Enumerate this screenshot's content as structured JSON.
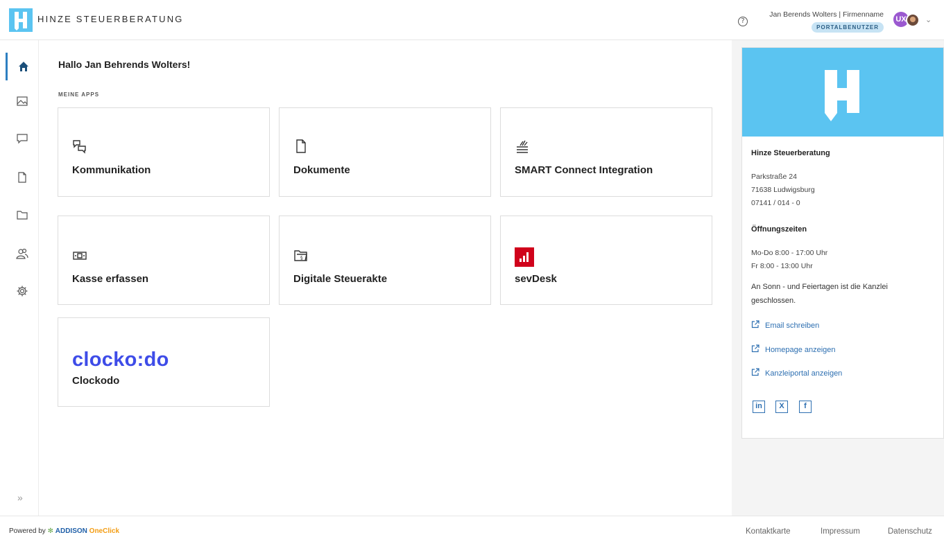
{
  "header": {
    "brand": "HINZE STEUERBERATUNG",
    "help_icon": "question-circle-icon",
    "user_name": "Jan Berends Wolters | Firmenname",
    "user_role": "PORTALBENUTZER",
    "avatar_initials": "UX"
  },
  "sidebar": {
    "items": [
      {
        "name": "home",
        "icon": "home-icon",
        "active": true
      },
      {
        "name": "images",
        "icon": "image-icon"
      },
      {
        "name": "messages",
        "icon": "chat-icon"
      },
      {
        "name": "documents",
        "icon": "document-icon"
      },
      {
        "name": "folders",
        "icon": "folder-icon"
      },
      {
        "name": "users",
        "icon": "users-icon"
      },
      {
        "name": "settings",
        "icon": "gear-icon"
      }
    ],
    "expand_label": "»"
  },
  "main": {
    "greeting": "Hallo Jan Behrends Wolters!",
    "section_title": "MEINE APPS",
    "apps": [
      {
        "label": "Kommunikation",
        "icon": "chat-bubbles-icon"
      },
      {
        "label": "Dokumente",
        "icon": "document-icon"
      },
      {
        "label": "SMART Connect Integration",
        "icon": "smart-connect-icon"
      },
      {
        "label": "Kasse erfassen",
        "icon": "cash-register-icon"
      },
      {
        "label": "Digitale Steuerakte",
        "icon": "paragraph-folder-icon"
      },
      {
        "label": "sevDesk",
        "icon": "sevdesk-logo"
      },
      {
        "label": "Clockodo",
        "logo_text": "clocko:do",
        "icon": "clockodo-logo"
      }
    ]
  },
  "contact": {
    "firm": "Hinze Steuerberatung",
    "street": "Parkstraße 24",
    "city": "71638 Ludwigsburg",
    "phone": "07141 / 014 - 0",
    "hours_title": "Öffnungszeiten",
    "hours_1": "Mo-Do 8:00 - 17:00 Uhr",
    "hours_2": "Fr 8:00 - 13:00 Uhr",
    "note": "An Sonn - und Feiertagen ist die Kanzlei geschlossen.",
    "links": [
      "Email schreiben",
      "Homepage anzeigen",
      "Kanzleiportal anzeigen"
    ],
    "social": [
      {
        "icon": "linkedin-icon",
        "glyph": "in"
      },
      {
        "icon": "xing-icon",
        "glyph": "X"
      },
      {
        "icon": "facebook-icon",
        "glyph": "f"
      }
    ],
    "accent_color": "#5bc4f1"
  },
  "footer": {
    "powered_prefix": "Powered by",
    "powered_brand": "ADDISON",
    "powered_product": "OneClick",
    "links": [
      "Kontaktkarte",
      "Impressum",
      "Datenschutz"
    ]
  }
}
